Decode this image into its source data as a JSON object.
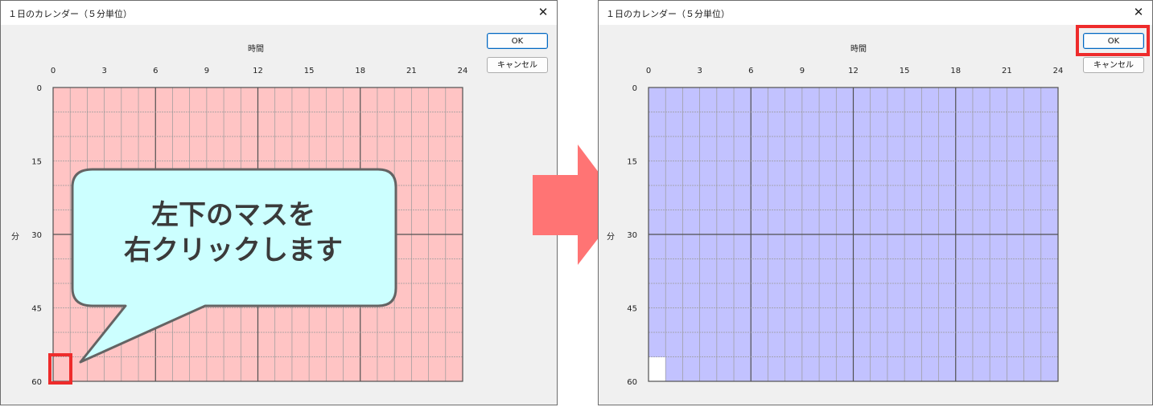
{
  "dialog": {
    "title": "１日のカレンダー（５分単位）",
    "close_glyph": "✕",
    "ok_label": "OK",
    "cancel_label": "キャンセル",
    "x_axis_title": "時間",
    "y_axis_title": "分",
    "x_ticks": [
      "0",
      "3",
      "6",
      "9",
      "12",
      "15",
      "18",
      "21",
      "24"
    ],
    "y_ticks": [
      "0",
      "15",
      "30",
      "45",
      "60"
    ],
    "hours": 24,
    "rows": 12
  },
  "before": {
    "grid_fill": "#ffc4c4",
    "callout_text_line1": "左下のマスを",
    "callout_text_line2": "右クリックします",
    "callout_fill": "#ccffff"
  },
  "after": {
    "grid_fill": "#c2c2ff",
    "unselected_cell": "hour 0, minutes 55–60"
  },
  "colors": {
    "highlight": "#ee2b2b",
    "arrow": "#ff7474"
  }
}
